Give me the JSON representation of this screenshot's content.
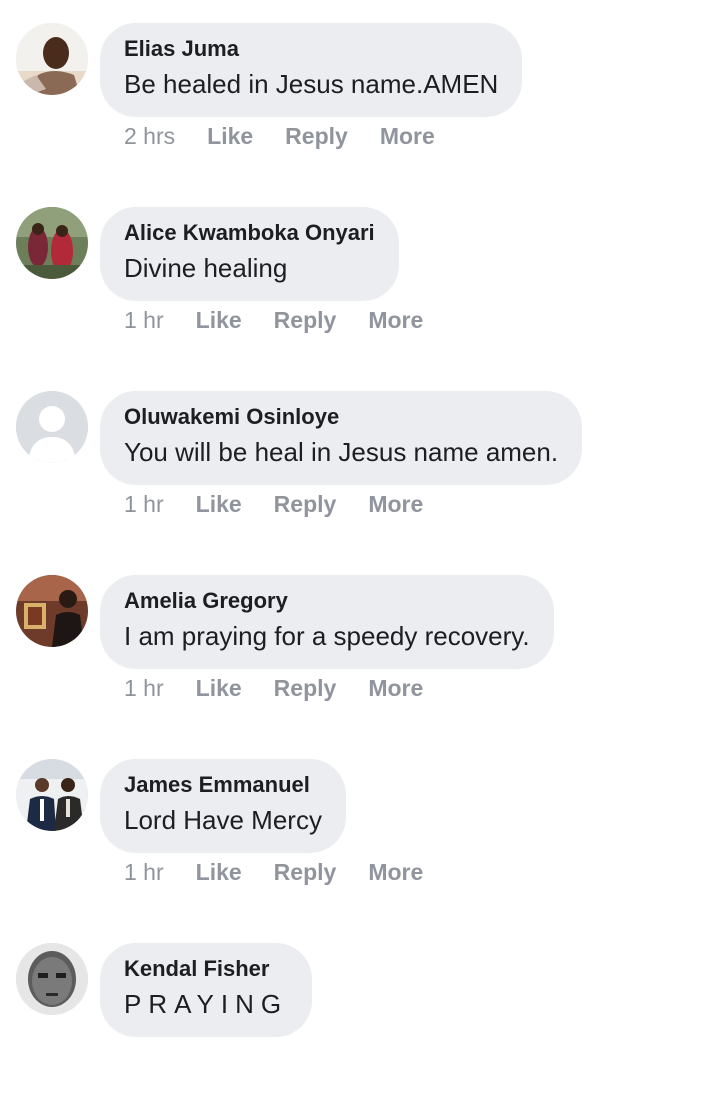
{
  "comments": [
    {
      "author": "Elias Juma",
      "text": "Be healed in Jesus name.AMEN",
      "time": "2 hrs",
      "like": "Like",
      "reply": "Reply",
      "more": "More"
    },
    {
      "author": "Alice Kwamboka Onyari",
      "text": "Divine healing",
      "time": "1 hr",
      "like": "Like",
      "reply": "Reply",
      "more": "More"
    },
    {
      "author": "Oluwakemi Osinloye",
      "text": "You will be heal in Jesus name amen.",
      "time": "1 hr",
      "like": "Like",
      "reply": "Reply",
      "more": "More"
    },
    {
      "author": "Amelia Gregory",
      "text": "I am praying for a speedy recovery.",
      "time": "1 hr",
      "like": "Like",
      "reply": "Reply",
      "more": "More"
    },
    {
      "author": "James Emmanuel",
      "text": "Lord Have Mercy",
      "time": "1 hr",
      "like": "Like",
      "reply": "Reply",
      "more": "More"
    },
    {
      "author": "Kendal Fisher",
      "text": "PRAYING"
    }
  ],
  "icons": {
    "avatar_placeholder": "default-profile-silhouette-icon"
  },
  "colors": {
    "bubble": "#ebedf0",
    "meta_text": "#90949c",
    "body_text": "#1c1e21"
  }
}
